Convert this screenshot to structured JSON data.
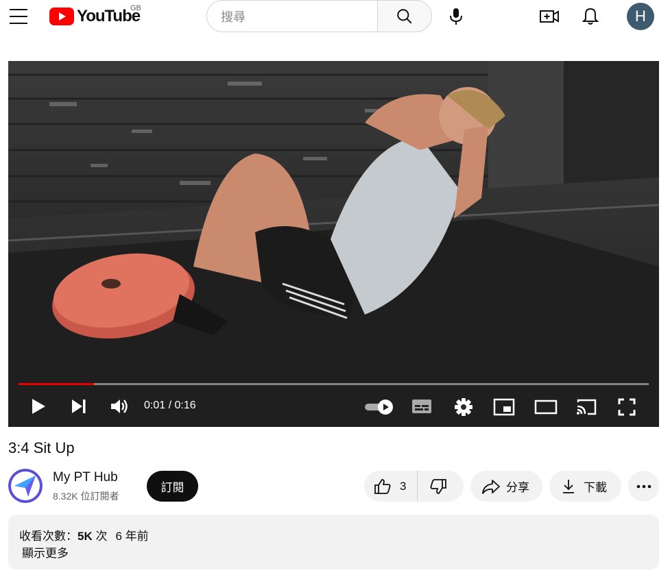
{
  "header": {
    "logo_text": "YouTube",
    "country_code": "GB",
    "search_placeholder": "搜尋",
    "avatar_letter": "H"
  },
  "player": {
    "progress_fraction": 0.12,
    "time_current": "0:01",
    "time_separator": " / ",
    "time_total": "0:16"
  },
  "video": {
    "title": "3:4 Sit Up"
  },
  "channel": {
    "name": "My PT Hub",
    "subscribers": "8.32K 位訂閱者",
    "subscribe_label": "訂閱"
  },
  "actions": {
    "like_count": "3",
    "share_label": "分享",
    "download_label": "下載"
  },
  "description": {
    "views_label": "收看次數：",
    "views_value": "5K",
    "views_unit": " 次",
    "age": "6 年前",
    "show_more": "顯示更多"
  },
  "colors": {
    "brand_red": "#ff0000",
    "progress_red": "#ee0000",
    "avatar_bg": "#3d5a6e"
  }
}
